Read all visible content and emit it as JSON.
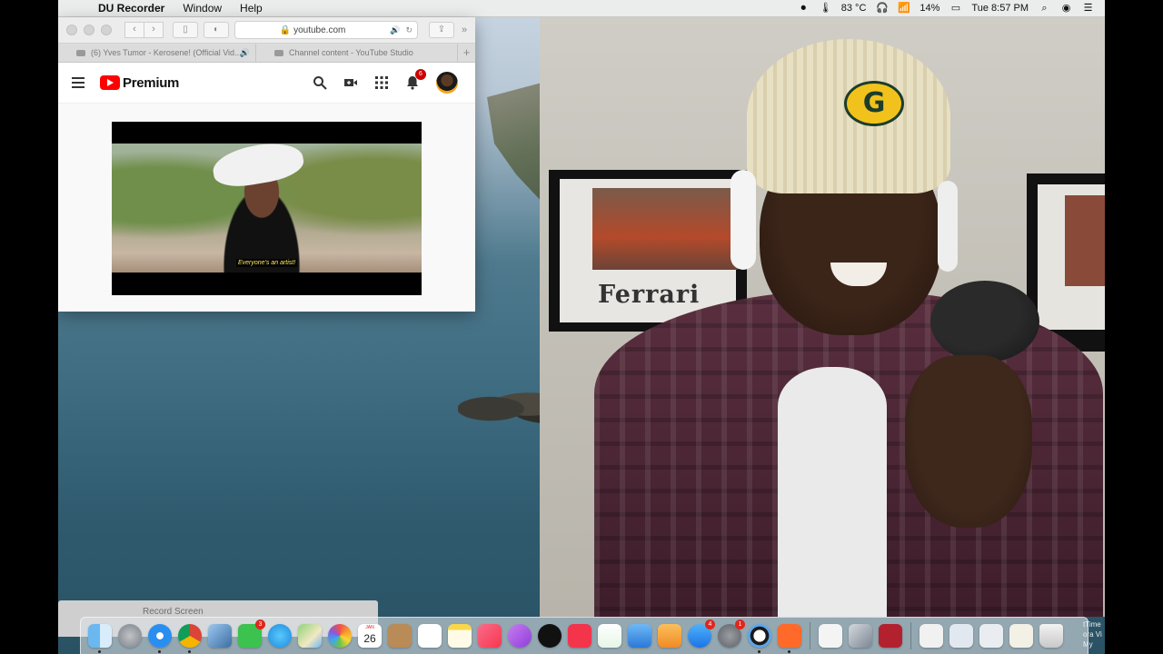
{
  "menubar": {
    "app_name": "DU Recorder",
    "menus": [
      "Window",
      "Help"
    ],
    "temperature": "83 °C",
    "battery": "14%",
    "clock": "Tue 8:57 PM"
  },
  "browser": {
    "url": "youtube.com",
    "tabs": [
      {
        "title": "(6) Yves Tumor - Kerosene! (Official Vid..."
      },
      {
        "title": "Channel content - YouTube Studio"
      }
    ]
  },
  "youtube": {
    "logo_text": "Premium",
    "notification_count": "6",
    "subtitle": "Everyone's an artist!"
  },
  "webcam": {
    "poster_text": "Ferrari",
    "beanie_logo": "G"
  },
  "record_label": "Record Screen",
  "dock": {
    "calendar_day": "26",
    "calendar_month": "JAN",
    "facetime_badge": "3",
    "appstore_badge": "4",
    "preferences_badge": "1",
    "side_label": "tTime\nora Vi\nMy"
  },
  "colors": {
    "youtube_red": "#ff0000",
    "badge_red": "#cc0000",
    "menubar_bg": "#ececec"
  }
}
